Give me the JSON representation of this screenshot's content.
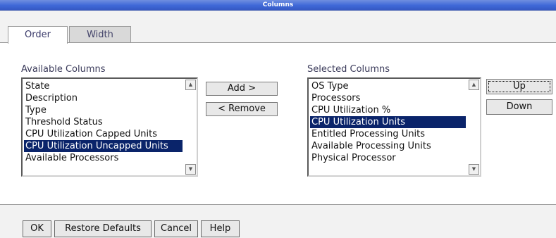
{
  "window": {
    "title": "Columns"
  },
  "tabs": [
    {
      "label": "Order",
      "active": true
    },
    {
      "label": "Width",
      "active": false
    }
  ],
  "available": {
    "label": "Available Columns",
    "items": [
      {
        "label": "State",
        "selected": false
      },
      {
        "label": "Description",
        "selected": false
      },
      {
        "label": "Type",
        "selected": false
      },
      {
        "label": "Threshold Status",
        "selected": false
      },
      {
        "label": "CPU Utilization Capped Units",
        "selected": false
      },
      {
        "label": "CPU Utilization Uncapped Units",
        "selected": true
      },
      {
        "label": "Available Processors",
        "selected": false
      }
    ]
  },
  "selected": {
    "label": "Selected Columns",
    "items": [
      {
        "label": "OS Type",
        "selected": false
      },
      {
        "label": "Processors",
        "selected": false
      },
      {
        "label": "CPU Utilization %",
        "selected": false
      },
      {
        "label": "CPU Utilization Units",
        "selected": true
      },
      {
        "label": "Entitled Processing Units",
        "selected": false
      },
      {
        "label": "Available Processing Units",
        "selected": false
      },
      {
        "label": "Physical Processor",
        "selected": false
      }
    ]
  },
  "buttons": {
    "add": "Add >",
    "remove": "< Remove",
    "up": "Up",
    "down": "Down",
    "ok": "OK",
    "restore": "Restore Defaults",
    "cancel": "Cancel",
    "help": "Help"
  },
  "icons": {
    "scroll_up": "scroll-up-arrow-icon",
    "scroll_down": "scroll-down-arrow-icon"
  },
  "colors": {
    "titlebar": "#3f68d8",
    "selection": "#0a246a"
  }
}
